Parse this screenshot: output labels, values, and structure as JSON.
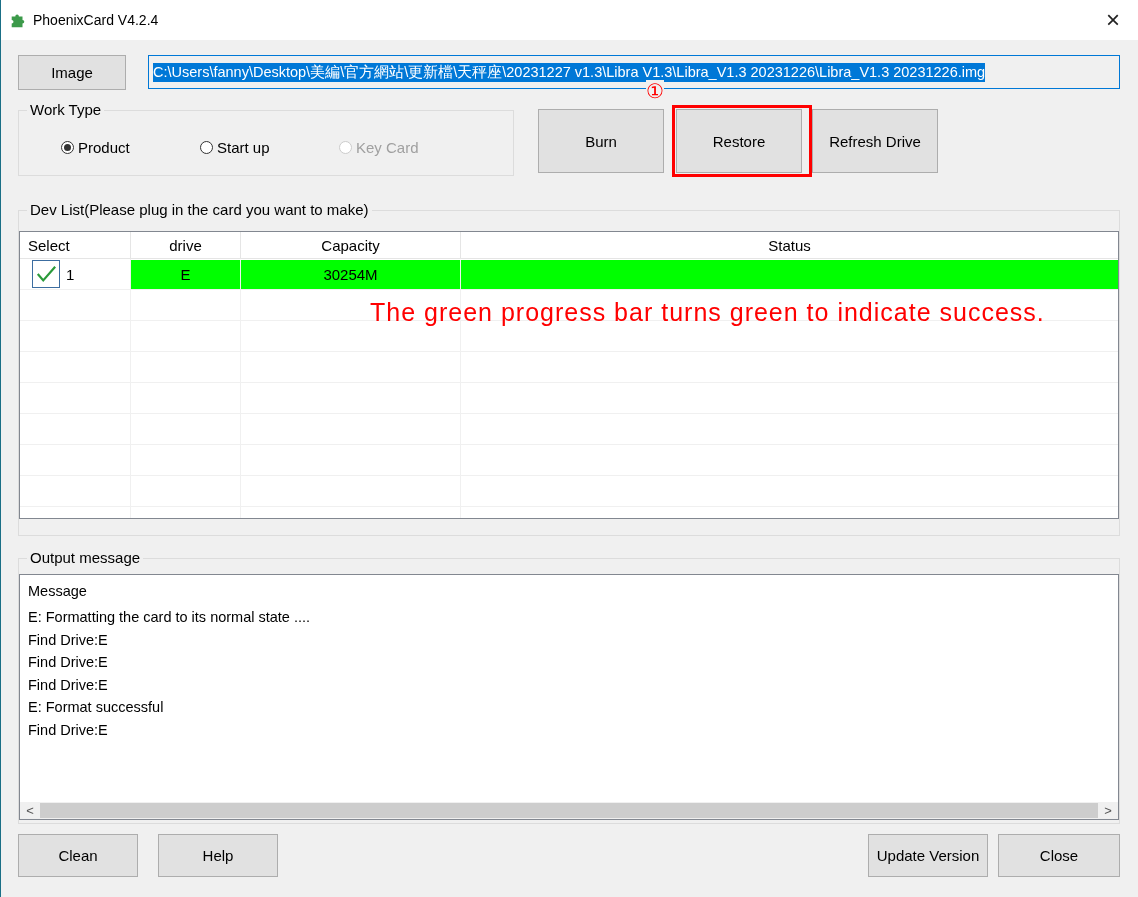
{
  "window": {
    "title": "PhoenixCard V4.2.4",
    "close": "×"
  },
  "image_button": "Image",
  "image_path": {
    "value": "C:\\Users\\fanny\\Desktop\\美編\\官方網站\\更新檔\\天秤座\\20231227 v1.3\\Libra V1.3\\Libra_V1.3 20231226\\Libra_V1.3 20231226.img",
    "selected": true
  },
  "work_type": {
    "title": "Work Type",
    "options": [
      {
        "label": "Product",
        "selected": true,
        "disabled": false
      },
      {
        "label": "Start up",
        "selected": false,
        "disabled": false
      },
      {
        "label": "Key Card",
        "selected": false,
        "disabled": true
      }
    ]
  },
  "actions": [
    {
      "label": "Burn",
      "highlighted": false
    },
    {
      "label": "Restore",
      "highlighted": true
    },
    {
      "label": "Refresh Drive",
      "highlighted": false
    }
  ],
  "step_marker": "①",
  "dev_list": {
    "title": "Dev List(Please plug in the card you want to make)",
    "columns": [
      "Select",
      "drive",
      "Capacity",
      "Status"
    ],
    "rows": [
      {
        "checked": true,
        "select": "1",
        "drive": "E",
        "capacity": "30254M",
        "status": "",
        "success": true
      }
    ]
  },
  "annotation": "The green progress bar turns green to indicate success.",
  "output": {
    "title": "Output message",
    "header": "Message",
    "lines": [
      "E: Formatting the card to its normal state ....",
      "Find Drive:E",
      "Find Drive:E",
      "Find Drive:E",
      "E: Format successful",
      "Find Drive:E"
    ]
  },
  "scroll_left": "<",
  "scroll_right": ">",
  "footer_left": [
    "Clean",
    "Help"
  ],
  "footer_right": [
    "Update Version",
    "Close"
  ]
}
